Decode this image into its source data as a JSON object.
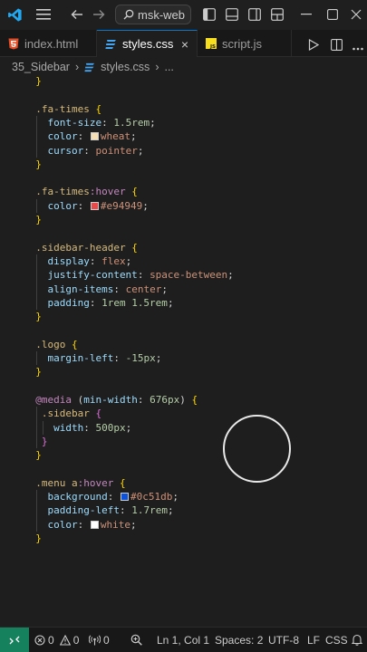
{
  "titlebar": {
    "search_text": "msk-web",
    "icons": [
      "vscode-logo-icon",
      "hamburger-menu-icon",
      "back-arrow-icon",
      "forward-arrow-icon",
      "search-icon",
      "toggle-sidebar-icon",
      "toggle-panel-icon",
      "toggle-secondary-sidebar-icon",
      "customize-layout-icon"
    ],
    "accent": "#0078d4"
  },
  "tabs": [
    {
      "label": "index.html",
      "icon": "html5-icon",
      "color": "#e44d26",
      "active": false
    },
    {
      "label": "styles.css",
      "icon": "css3-icon",
      "color": "#42a5f5",
      "active": true,
      "close": "×"
    },
    {
      "label": "script.js",
      "icon": "javascript-icon",
      "color": "#f7df1e",
      "active": false
    }
  ],
  "breadcrumb": {
    "folder": "35_Sidebar",
    "file": "styles.css",
    "separator": "›",
    "more": "..."
  },
  "editor": {
    "lines": [
      {
        "indent": 2,
        "tokens": [
          {
            "t": "}",
            "c": "brace"
          }
        ]
      },
      {
        "indent": 0,
        "tokens": []
      },
      {
        "indent": 2,
        "tokens": [
          {
            "t": ".fa-times",
            "c": "sel"
          },
          {
            "t": " ",
            "c": "pun"
          },
          {
            "t": "{",
            "c": "brace"
          }
        ]
      },
      {
        "indent": 4,
        "tokens": [
          {
            "t": "font-size",
            "c": "prop"
          },
          {
            "t": ": ",
            "c": "pun"
          },
          {
            "t": "1.5rem",
            "c": "num"
          },
          {
            "t": ";",
            "c": "pun"
          }
        ]
      },
      {
        "indent": 4,
        "tokens": [
          {
            "t": "color",
            "c": "prop"
          },
          {
            "t": ": ",
            "c": "pun"
          },
          {
            "swatch": "#f5deb3"
          },
          {
            "t": "wheat",
            "c": "val"
          },
          {
            "t": ";",
            "c": "pun"
          }
        ]
      },
      {
        "indent": 4,
        "tokens": [
          {
            "t": "cursor",
            "c": "prop"
          },
          {
            "t": ": ",
            "c": "pun"
          },
          {
            "t": "pointer",
            "c": "val"
          },
          {
            "t": ";",
            "c": "pun"
          }
        ]
      },
      {
        "indent": 2,
        "tokens": [
          {
            "t": "}",
            "c": "brace"
          }
        ]
      },
      {
        "indent": 0,
        "tokens": []
      },
      {
        "indent": 2,
        "tokens": [
          {
            "t": ".fa-times",
            "c": "sel"
          },
          {
            "t": ":hover",
            "c": "at"
          },
          {
            "t": " ",
            "c": "pun"
          },
          {
            "t": "{",
            "c": "brace"
          }
        ]
      },
      {
        "indent": 4,
        "tokens": [
          {
            "t": "color",
            "c": "prop"
          },
          {
            "t": ": ",
            "c": "pun"
          },
          {
            "swatch": "#e94949"
          },
          {
            "t": "#e94949",
            "c": "val"
          },
          {
            "t": ";",
            "c": "pun"
          }
        ]
      },
      {
        "indent": 2,
        "tokens": [
          {
            "t": "}",
            "c": "brace"
          }
        ]
      },
      {
        "indent": 0,
        "tokens": []
      },
      {
        "indent": 2,
        "tokens": [
          {
            "t": ".sidebar-header",
            "c": "sel"
          },
          {
            "t": " ",
            "c": "pun"
          },
          {
            "t": "{",
            "c": "brace"
          }
        ]
      },
      {
        "indent": 4,
        "tokens": [
          {
            "t": "display",
            "c": "prop"
          },
          {
            "t": ": ",
            "c": "pun"
          },
          {
            "t": "flex",
            "c": "val"
          },
          {
            "t": ";",
            "c": "pun"
          }
        ]
      },
      {
        "indent": 4,
        "tokens": [
          {
            "t": "justify-content",
            "c": "prop"
          },
          {
            "t": ": ",
            "c": "pun"
          },
          {
            "t": "space-between",
            "c": "val"
          },
          {
            "t": ";",
            "c": "pun"
          }
        ]
      },
      {
        "indent": 4,
        "tokens": [
          {
            "t": "align-items",
            "c": "prop"
          },
          {
            "t": ": ",
            "c": "pun"
          },
          {
            "t": "center",
            "c": "val"
          },
          {
            "t": ";",
            "c": "pun"
          }
        ]
      },
      {
        "indent": 4,
        "tokens": [
          {
            "t": "padding",
            "c": "prop"
          },
          {
            "t": ": ",
            "c": "pun"
          },
          {
            "t": "1rem 1.5rem",
            "c": "num"
          },
          {
            "t": ";",
            "c": "pun"
          }
        ]
      },
      {
        "indent": 2,
        "tokens": [
          {
            "t": "}",
            "c": "brace"
          }
        ]
      },
      {
        "indent": 0,
        "tokens": []
      },
      {
        "indent": 2,
        "tokens": [
          {
            "t": ".logo",
            "c": "sel"
          },
          {
            "t": " ",
            "c": "pun"
          },
          {
            "t": "{",
            "c": "brace"
          }
        ]
      },
      {
        "indent": 4,
        "tokens": [
          {
            "t": "margin-left",
            "c": "prop"
          },
          {
            "t": ": ",
            "c": "pun"
          },
          {
            "t": "-15px",
            "c": "num"
          },
          {
            "t": ";",
            "c": "pun"
          }
        ]
      },
      {
        "indent": 2,
        "tokens": [
          {
            "t": "}",
            "c": "brace"
          }
        ]
      },
      {
        "indent": 0,
        "tokens": []
      },
      {
        "indent": 2,
        "tokens": [
          {
            "t": "@media",
            "c": "at"
          },
          {
            "t": " (",
            "c": "pun"
          },
          {
            "t": "min-width",
            "c": "prop"
          },
          {
            "t": ": ",
            "c": "pun"
          },
          {
            "t": "676px",
            "c": "num"
          },
          {
            "t": ") ",
            "c": "pun"
          },
          {
            "t": "{",
            "c": "brace"
          }
        ]
      },
      {
        "indent": 3,
        "tokens": [
          {
            "t": ".sidebar",
            "c": "sel"
          },
          {
            "t": " ",
            "c": "pun"
          },
          {
            "t": "{",
            "c": "brace2"
          }
        ]
      },
      {
        "indent": 5,
        "tokens": [
          {
            "t": "width",
            "c": "prop"
          },
          {
            "t": ": ",
            "c": "pun"
          },
          {
            "t": "500px",
            "c": "num"
          },
          {
            "t": ";",
            "c": "pun"
          }
        ]
      },
      {
        "indent": 3,
        "tokens": [
          {
            "t": "}",
            "c": "brace2"
          }
        ]
      },
      {
        "indent": 2,
        "tokens": [
          {
            "t": "}",
            "c": "brace"
          }
        ]
      },
      {
        "indent": 0,
        "tokens": []
      },
      {
        "indent": 2,
        "tokens": [
          {
            "t": ".menu a",
            "c": "sel"
          },
          {
            "t": ":hover",
            "c": "at"
          },
          {
            "t": " ",
            "c": "pun"
          },
          {
            "t": "{",
            "c": "brace"
          }
        ]
      },
      {
        "indent": 4,
        "tokens": [
          {
            "t": "background",
            "c": "prop"
          },
          {
            "t": ": ",
            "c": "pun"
          },
          {
            "swatch": "#0c51db"
          },
          {
            "t": "#0c51db",
            "c": "val"
          },
          {
            "t": ";",
            "c": "pun"
          }
        ]
      },
      {
        "indent": 4,
        "tokens": [
          {
            "t": "padding-left",
            "c": "prop"
          },
          {
            "t": ": ",
            "c": "pun"
          },
          {
            "t": "1.7rem",
            "c": "num"
          },
          {
            "t": ";",
            "c": "pun"
          }
        ]
      },
      {
        "indent": 4,
        "tokens": [
          {
            "t": "color",
            "c": "prop"
          },
          {
            "t": ": ",
            "c": "pun"
          },
          {
            "swatch": "#ffffff"
          },
          {
            "t": "white",
            "c": "val"
          },
          {
            "t": ";",
            "c": "pun"
          }
        ]
      },
      {
        "indent": 2,
        "tokens": [
          {
            "t": "}",
            "c": "brace"
          }
        ]
      }
    ]
  },
  "statusbar": {
    "remote_icon": "remote-icon",
    "errors": "0",
    "warnings": "0",
    "ports": "0",
    "position": "Ln 1, Col 1",
    "spaces": "Spaces: 2",
    "encoding": "UTF-8",
    "eol": "LF",
    "language": "CSS",
    "remote_color": "#16825d"
  }
}
